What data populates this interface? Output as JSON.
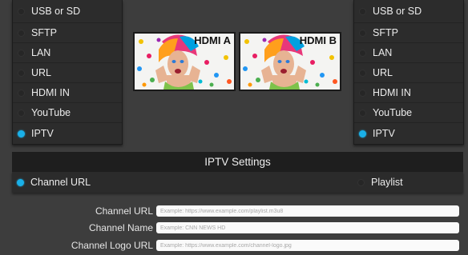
{
  "left_sources": {
    "items": [
      {
        "label": "USB or SD",
        "selected": false
      },
      {
        "label": "SFTP",
        "selected": false
      },
      {
        "label": "LAN",
        "selected": false
      },
      {
        "label": "URL",
        "selected": false
      },
      {
        "label": "HDMI IN",
        "selected": false
      },
      {
        "label": "YouTube",
        "selected": false
      },
      {
        "label": "IPTV",
        "selected": true
      }
    ]
  },
  "right_sources": {
    "items": [
      {
        "label": "USB or SD",
        "selected": false
      },
      {
        "label": "SFTP",
        "selected": false
      },
      {
        "label": "LAN",
        "selected": false
      },
      {
        "label": "URL",
        "selected": false
      },
      {
        "label": "HDMI IN",
        "selected": false
      },
      {
        "label": "YouTube",
        "selected": false
      },
      {
        "label": "IPTV",
        "selected": true
      }
    ]
  },
  "previews": {
    "a_label": "HDMI A",
    "b_label": "HDMI B"
  },
  "settings": {
    "title": "IPTV Settings",
    "mode_channel_url": "Channel URL",
    "mode_playlist": "Playlist",
    "selected_mode": "channel_url",
    "fields": {
      "channel_url": {
        "label": "Channel URL",
        "placeholder": "Example: https://www.example.com/playlist.m3u8",
        "value": ""
      },
      "channel_name": {
        "label": "Channel Name",
        "placeholder": "Example: CNN NEWS HD",
        "value": ""
      },
      "channel_logo_url": {
        "label": "Channel Logo URL",
        "placeholder": "Example: https://www.example.com/channel-logo.jpg",
        "value": ""
      }
    }
  },
  "colors": {
    "accent": "#1ab0e8",
    "background": "#3d3d3d",
    "panel": "#2c2c2c",
    "header": "#1e1e1e"
  }
}
